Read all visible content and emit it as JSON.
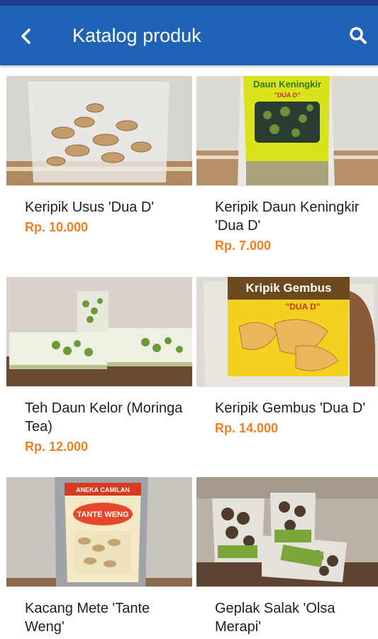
{
  "header": {
    "title": "Katalog produk"
  },
  "products": [
    {
      "name": "Keripik Usus 'Dua D'",
      "price": "Rp. 10.000"
    },
    {
      "name": "Keripik Daun Keningkir 'Dua D'",
      "price": "Rp. 7.000",
      "package_text": "Daun Keningkir",
      "package_sub": "\"DUA D\""
    },
    {
      "name": "Teh Daun Kelor (Moringa Tea)",
      "price": "Rp. 12.000"
    },
    {
      "name": "Keripik Gembus 'Dua D'",
      "price": "Rp. 14.000",
      "package_text": "Kripik Gembus",
      "package_sub": "\"DUA D\""
    },
    {
      "name": "Kacang Mete 'Tante Weng'",
      "price": "",
      "package_top": "ANEKA CAMILAN",
      "package_text": "TANTE WENG"
    },
    {
      "name": "Geplak Salak 'Olsa Merapi'",
      "price": ""
    }
  ],
  "colors": {
    "app_bar": "#1f63b7",
    "status_strip": "#1f3f8f",
    "price": "#f07f22"
  },
  "icons": [
    "back-arrow-icon",
    "search-icon"
  ]
}
